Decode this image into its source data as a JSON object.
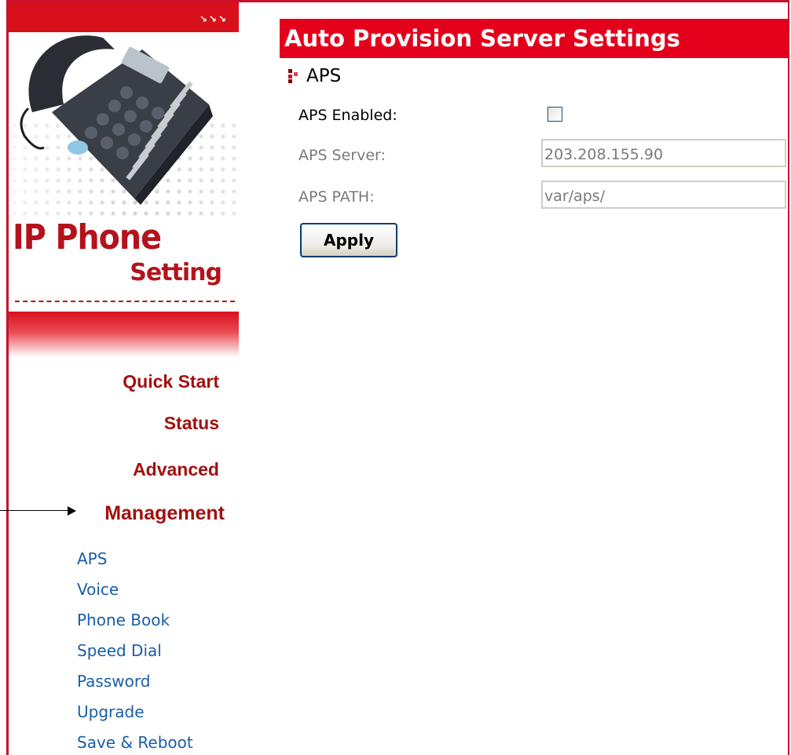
{
  "sidebar": {
    "brand": {
      "title": "IP Phone",
      "subtitle": "Setting",
      "arrows": "ↄↄↄ"
    },
    "nav_main": [
      {
        "label": "Quick Start"
      },
      {
        "label": "Status"
      },
      {
        "label": "Advanced"
      },
      {
        "label": "Management"
      }
    ],
    "nav_sub": [
      {
        "label": "APS"
      },
      {
        "label": "Voice"
      },
      {
        "label": "Phone Book"
      },
      {
        "label": "Speed Dial"
      },
      {
        "label": "Password"
      },
      {
        "label": "Upgrade"
      },
      {
        "label": "Save & Reboot"
      }
    ]
  },
  "main": {
    "header": "Auto Provision Server Settings",
    "section": "APS",
    "fields": {
      "enabled_label": "APS Enabled:",
      "enabled_checked": false,
      "server_label": "APS Server:",
      "server_value": "203.208.155.90",
      "path_label": "APS PATH:",
      "path_value": "var/aps/"
    },
    "apply_label": "Apply"
  },
  "colors": {
    "accent": "#e4001b",
    "nav_main": "#a11010",
    "nav_sub": "#1a5ea8"
  }
}
